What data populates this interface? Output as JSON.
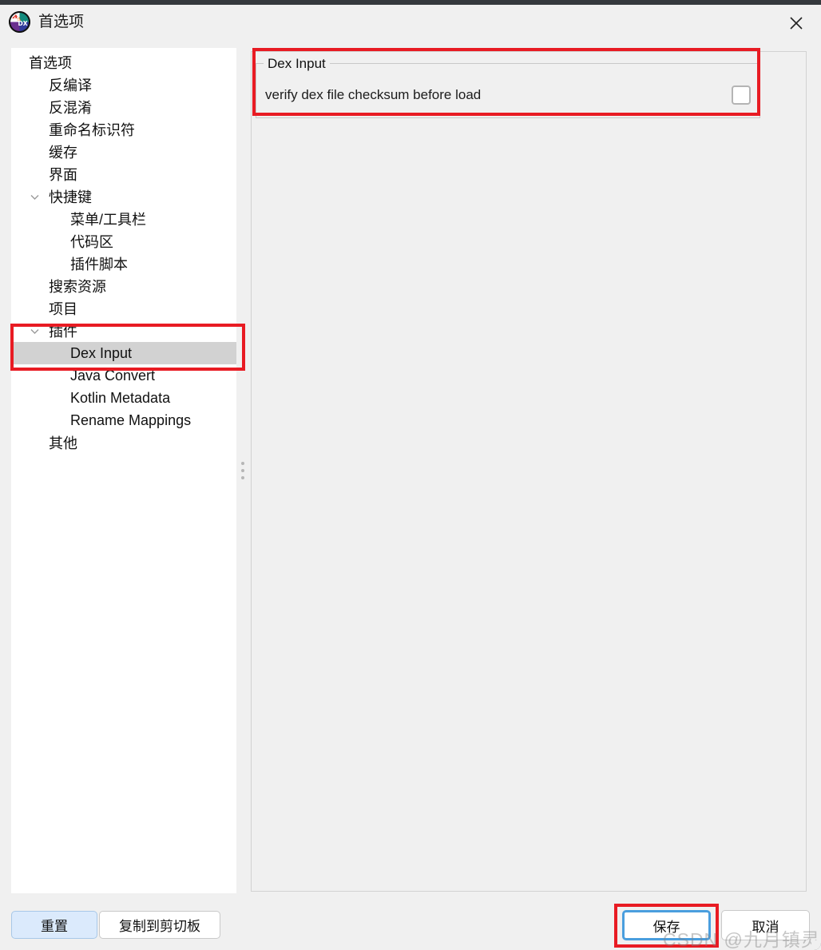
{
  "window": {
    "title": "首选项",
    "app_icon": "jadx-logo-icon",
    "close_label": "×"
  },
  "sidebar": {
    "items": [
      {
        "label": "首选项",
        "level": 0,
        "chevron": "",
        "selected": false
      },
      {
        "label": "反编译",
        "level": 1,
        "chevron": "",
        "selected": false
      },
      {
        "label": "反混淆",
        "level": 1,
        "chevron": "",
        "selected": false
      },
      {
        "label": "重命名标识符",
        "level": 1,
        "chevron": "",
        "selected": false
      },
      {
        "label": "缓存",
        "level": 1,
        "chevron": "",
        "selected": false
      },
      {
        "label": "界面",
        "level": 1,
        "chevron": "",
        "selected": false
      },
      {
        "label": "快捷键",
        "level": 1,
        "chevron": "down",
        "selected": false
      },
      {
        "label": "菜单/工具栏",
        "level": 2,
        "chevron": "",
        "selected": false
      },
      {
        "label": "代码区",
        "level": 2,
        "chevron": "",
        "selected": false
      },
      {
        "label": "插件脚本",
        "level": 2,
        "chevron": "",
        "selected": false
      },
      {
        "label": "搜索资源",
        "level": 1,
        "chevron": "",
        "selected": false
      },
      {
        "label": "项目",
        "level": 1,
        "chevron": "",
        "selected": false
      },
      {
        "label": "插件",
        "level": 1,
        "chevron": "down",
        "selected": false
      },
      {
        "label": "Dex Input",
        "level": 2,
        "chevron": "",
        "selected": true
      },
      {
        "label": "Java Convert",
        "level": 2,
        "chevron": "",
        "selected": false
      },
      {
        "label": "Kotlin Metadata",
        "level": 2,
        "chevron": "",
        "selected": false
      },
      {
        "label": "Rename Mappings",
        "level": 2,
        "chevron": "",
        "selected": false
      },
      {
        "label": "其他",
        "level": 1,
        "chevron": "",
        "selected": false
      }
    ]
  },
  "content": {
    "group_title": "Dex Input",
    "option_label": "verify dex file checksum before load",
    "option_checked": false
  },
  "footer": {
    "reset_label": "重置",
    "copy_label": "复制到剪切板",
    "save_label": "保存",
    "cancel_label": "取消"
  },
  "annotations": {
    "highlight_color": "#e81b23",
    "focus_color": "#4a9ede"
  },
  "watermark": {
    "text": "CSDN @九月镇灵将"
  }
}
